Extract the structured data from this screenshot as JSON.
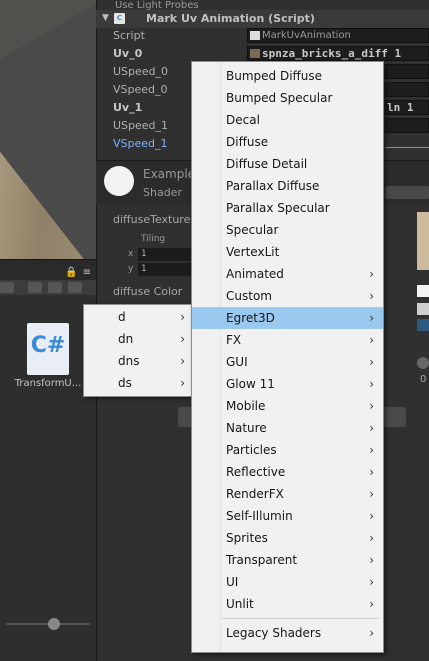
{
  "inspector": {
    "cut_row": "Use Light Probes",
    "component_title": "Mark Uv Animation (Script)",
    "props": [
      {
        "label": "Script",
        "value": "MarkUvAnimation"
      },
      {
        "label": "Uv_0",
        "value": "spnza_bricks_a_diff 1"
      },
      {
        "label": "USpeed_0",
        "value": ""
      },
      {
        "label": "VSpeed_0",
        "value": ""
      },
      {
        "label": "Uv_1",
        "value": "ln 1"
      },
      {
        "label": "USpeed_1",
        "value": ""
      },
      {
        "label": "VSpeed_1",
        "value": ""
      }
    ],
    "material_title": "Example",
    "material_shader_label": "Shader",
    "diffuse_texture_label": "diffuseTexture",
    "tiling_label": "Tiling",
    "tiling_x_label": "x",
    "tiling_x": "1",
    "tiling_y_label": "y",
    "tiling_y": "1",
    "diffuse_color_label": "diffuse Color",
    "right_number": "0"
  },
  "project": {
    "asset_name": "TransformU...",
    "asset_glyph": "C#"
  },
  "menus": {
    "main_items": [
      {
        "label": "Bumped Diffuse",
        "submenu": false
      },
      {
        "label": "Bumped Specular",
        "submenu": false
      },
      {
        "label": "Decal",
        "submenu": false
      },
      {
        "label": "Diffuse",
        "submenu": false
      },
      {
        "label": "Diffuse Detail",
        "submenu": false
      },
      {
        "label": "Parallax Diffuse",
        "submenu": false
      },
      {
        "label": "Parallax Specular",
        "submenu": false
      },
      {
        "label": "Specular",
        "submenu": false
      },
      {
        "label": "VertexLit",
        "submenu": false
      },
      {
        "label": "Animated",
        "submenu": true
      },
      {
        "label": "Custom",
        "submenu": true
      },
      {
        "label": "Egret3D",
        "submenu": true,
        "highlighted": true
      },
      {
        "label": "FX",
        "submenu": true
      },
      {
        "label": "GUI",
        "submenu": true
      },
      {
        "label": "Glow 11",
        "submenu": true
      },
      {
        "label": "Mobile",
        "submenu": true
      },
      {
        "label": "Nature",
        "submenu": true
      },
      {
        "label": "Particles",
        "submenu": true
      },
      {
        "label": "Reflective",
        "submenu": true
      },
      {
        "label": "RenderFX",
        "submenu": true
      },
      {
        "label": "Self-Illumin",
        "submenu": true
      },
      {
        "label": "Sprites",
        "submenu": true
      },
      {
        "label": "Transparent",
        "submenu": true
      },
      {
        "label": "UI",
        "submenu": true
      },
      {
        "label": "Unlit",
        "submenu": true
      },
      {
        "label": "Legacy Shaders",
        "submenu": true
      }
    ],
    "sub_items": [
      {
        "label": "d",
        "submenu": true
      },
      {
        "label": "dn",
        "submenu": true
      },
      {
        "label": "dns",
        "submenu": true
      },
      {
        "label": "ds",
        "submenu": true
      }
    ],
    "arrow_glyph": "›",
    "highlight_color": "#99c9ef"
  }
}
